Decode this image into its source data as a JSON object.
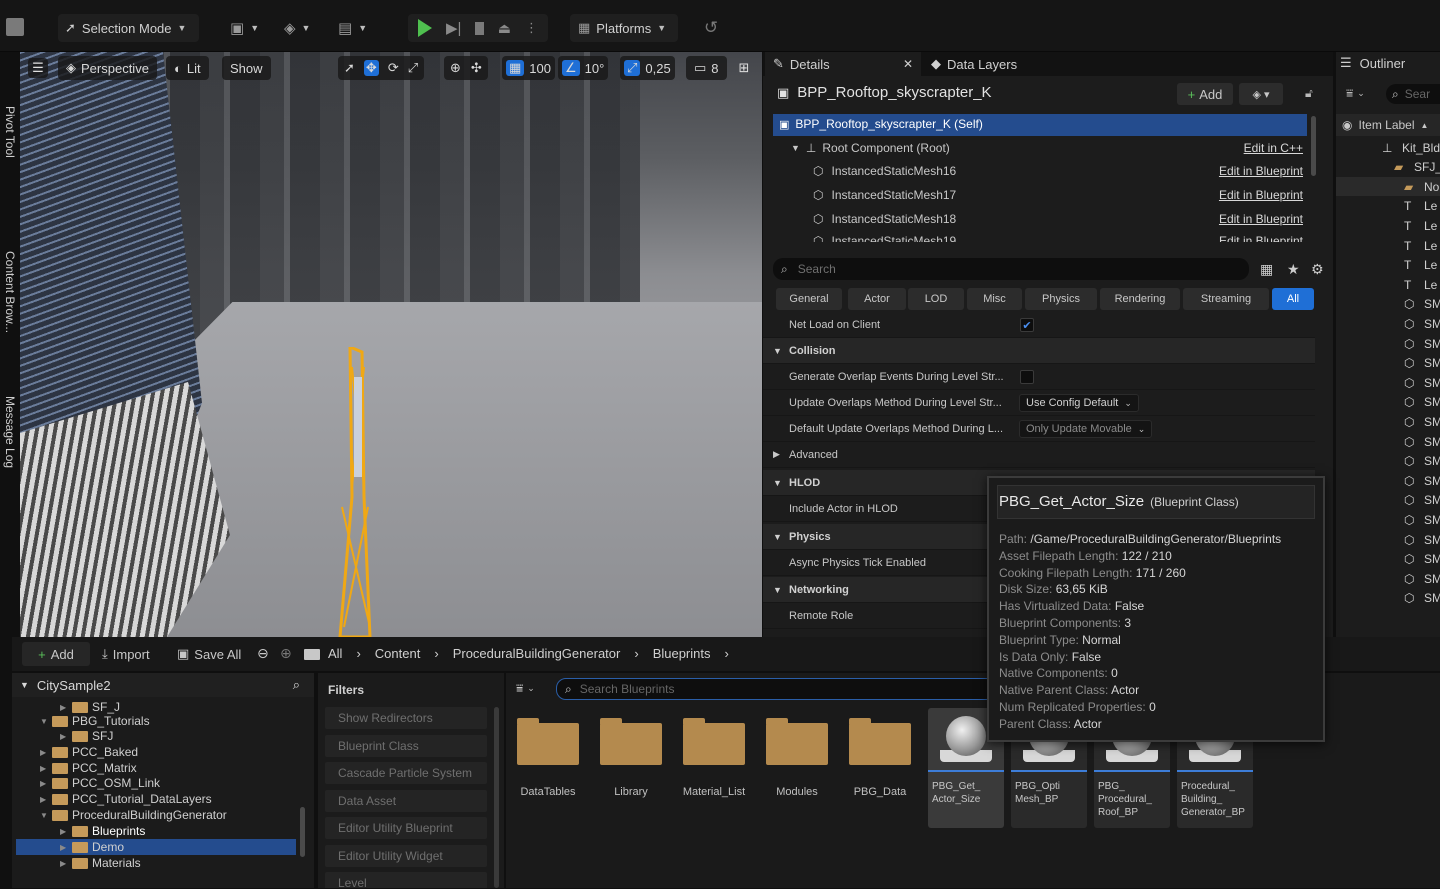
{
  "toolbar": {
    "selection_mode": "Selection Mode",
    "platforms": "Platforms"
  },
  "left_tabs": [
    "Pivot Tool",
    "Content Brow...",
    "Message Log"
  ],
  "viewport": {
    "perspective": "Perspective",
    "lit": "Lit",
    "show": "Show",
    "grid_snap": "100",
    "rot_snap": "10°",
    "scale_snap": "0,25",
    "camera_speed": "8"
  },
  "details": {
    "tab_details": "Details",
    "tab_datalayers": "Data Layers",
    "actor_name": "BPP_Rooftop_skyscrapter_K",
    "add": "Add",
    "tree": [
      {
        "label": "BPP_Rooftop_skyscrapter_K (Self)",
        "link": ""
      },
      {
        "label": "Root Component (Root)",
        "link": "Edit in C++"
      },
      {
        "label": "InstancedStaticMesh16",
        "link": "Edit in Blueprint"
      },
      {
        "label": "InstancedStaticMesh17",
        "link": "Edit in Blueprint"
      },
      {
        "label": "InstancedStaticMesh18",
        "link": "Edit in Blueprint"
      },
      {
        "label": "InstancedStaticMesh19",
        "link": "Edit in Blueprint"
      }
    ],
    "search_placeholder": "Search",
    "filters": [
      "General",
      "Actor",
      "LOD",
      "Misc",
      "Physics",
      "Rendering",
      "Streaming",
      "All"
    ],
    "props": {
      "net_load": "Net Load on Client",
      "collision": "Collision",
      "gen_overlap": "Generate Overlap Events During Level Str...",
      "update_overlap": "Update Overlaps Method During Level Str...",
      "update_overlap_val": "Use Config Default",
      "default_overlap": "Default Update Overlaps Method During L...",
      "default_overlap_val": "Only Update Movable",
      "advanced": "Advanced",
      "hlod": "HLOD",
      "include_hlod": "Include Actor in HLOD",
      "physics": "Physics",
      "async_physics": "Async Physics Tick Enabled",
      "networking": "Networking",
      "remote_role": "Remote Role"
    }
  },
  "outliner": {
    "title": "Outliner",
    "search_placeholder": "Sear",
    "col": "Item Label",
    "rows": [
      "Kit_Bld",
      "SFJ_",
      "No",
      "Le",
      "Le",
      "Le",
      "Le",
      "Le",
      "SM",
      "SM",
      "SM",
      "SM",
      "SM",
      "SM",
      "SM",
      "SM",
      "SM",
      "SM",
      "SM",
      "SM",
      "SM",
      "SM",
      "SM",
      "SM"
    ]
  },
  "content": {
    "add": "Add",
    "import": "Import",
    "save_all": "Save All",
    "breadcrumb": [
      "All",
      "Content",
      "ProceduralBuildingGenerator",
      "Blueprints"
    ],
    "root": "CitySample2",
    "tree": [
      {
        "label": "SF_J",
        "indent": 1
      },
      {
        "label": "PBG_Tutorials",
        "indent": 0
      },
      {
        "label": "SFJ",
        "indent": 1
      },
      {
        "label": "PCC_Baked",
        "indent": 0
      },
      {
        "label": "PCC_Matrix",
        "indent": 0
      },
      {
        "label": "PCC_OSM_Link",
        "indent": 0
      },
      {
        "label": "PCC_Tutorial_DataLayers",
        "indent": 0
      },
      {
        "label": "ProceduralBuildingGenerator",
        "indent": 0
      },
      {
        "label": "Blueprints",
        "indent": 1
      },
      {
        "label": "Demo",
        "indent": 1
      },
      {
        "label": "Materials",
        "indent": 1
      }
    ],
    "filters_title": "Filters",
    "filters": [
      "Show Redirectors",
      "Blueprint Class",
      "Cascade Particle System",
      "Data Asset",
      "Editor Utility Blueprint",
      "Editor Utility Widget",
      "Level"
    ],
    "search_placeholder": "Search Blueprints",
    "folders": [
      "DataTables",
      "Library",
      "Material_List",
      "Modules",
      "PBG_Data"
    ],
    "assets": [
      "PBG_Get_\nActor_Size",
      "PBG_Opti\nMesh_BP",
      "PBG_\nProcedural_\nRoof_BP",
      "Procedural_\nBuilding_\nGenerator_BP"
    ]
  },
  "tooltip": {
    "title": "PBG_Get_Actor_Size",
    "type": "(Blueprint Class)",
    "lines": [
      {
        "k": "Path:",
        "v": "/Game/ProceduralBuildingGenerator/Blueprints"
      },
      {
        "k": "Asset Filepath Length:",
        "v": "122 / 210"
      },
      {
        "k": "Cooking Filepath Length:",
        "v": "171 / 260"
      },
      {
        "k": "Disk Size:",
        "v": "63,65 KiB"
      },
      {
        "k": "Has Virtualized Data:",
        "v": "False"
      },
      {
        "k": "Blueprint Components:",
        "v": "3"
      },
      {
        "k": "Blueprint Type:",
        "v": "Normal"
      },
      {
        "k": "Is Data Only:",
        "v": "False"
      },
      {
        "k": "Native Components:",
        "v": "0"
      },
      {
        "k": "Native Parent Class:",
        "v": "Actor"
      },
      {
        "k": "Num Replicated Properties:",
        "v": "0"
      },
      {
        "k": "Parent Class:",
        "v": "Actor"
      }
    ]
  },
  "colors": {
    "accent": "#1f6fd6",
    "play": "#4fc04f",
    "folder": "#c59a5a"
  }
}
